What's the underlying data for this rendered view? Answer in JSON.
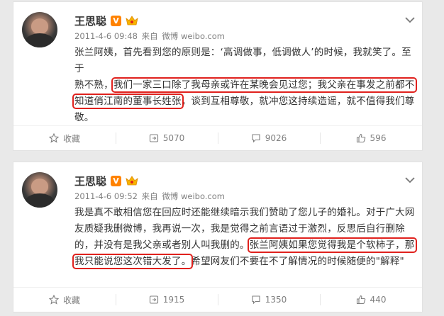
{
  "posts": [
    {
      "user": {
        "name": "王思聪",
        "vip_label": "V"
      },
      "meta": {
        "time": "2011-4-6 09:48",
        "from_label": "来自",
        "source": "微博 weibo.com"
      },
      "content": {
        "lines": [
          "张兰阿姨，首先看到您的原则是：‘高调做事，低调做人’的时候，我就笑了。至于",
          "熟不熟，",
          "我们一家三口除了我母亲或许在某晚会见过您；我父亲在事发之前都不",
          "知道俏江南的董事长姓张",
          "，谈到互相尊敬，就冲您这持续造谣，就不值得我们尊",
          "敬。"
        ]
      },
      "actions": {
        "favorite": "收藏",
        "repost": "5070",
        "comment": "9026",
        "like": "596"
      }
    },
    {
      "user": {
        "name": "王思聪",
        "vip_label": "V"
      },
      "meta": {
        "time": "2011-4-6 09:52",
        "from_label": "来自",
        "source": "微博 weibo.com"
      },
      "content": {
        "lines": [
          "我是真不敢相信您在回应时还能继续暗示我们赞助了您儿子的婚礼。对于广大网",
          "友质疑我删微博，我再说一次，我是觉得之前言语过于激烈，反思后自行删除",
          "的，并没有是我父亲或者别人叫我删的。",
          "张兰阿姨如果您觉得我是个软柿子，那",
          "我只能说您这次错大发了。",
          "希望网友们不要在不了解情况的时候随便的\"解释\""
        ]
      },
      "actions": {
        "favorite": "收藏",
        "repost": "1915",
        "comment": "1350",
        "like": "440"
      }
    }
  ],
  "colors": {
    "highlight": "#e0211d",
    "vip": "#ff8200",
    "muted": "#808080"
  }
}
